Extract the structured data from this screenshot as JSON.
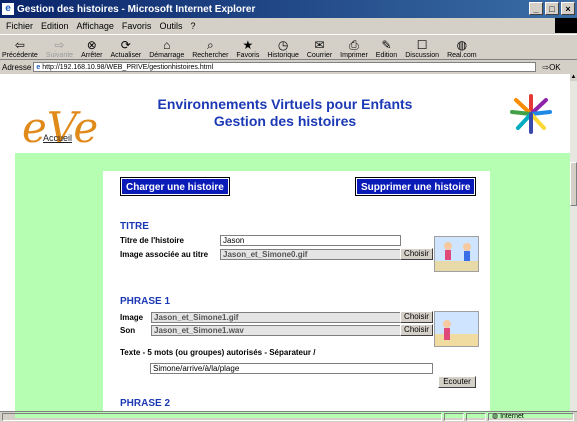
{
  "window": {
    "title": "Gestion des histoires - Microsoft Internet Explorer",
    "buttons": [
      "_",
      "□",
      "×"
    ]
  },
  "menu": {
    "items": [
      "Fichier",
      "Edition",
      "Affichage",
      "Favoris",
      "Outils",
      "?"
    ]
  },
  "toolbar": {
    "buttons": [
      {
        "label": "Précédente",
        "icon": "back-arrow",
        "glyph": "⇦"
      },
      {
        "label": "Suivante",
        "icon": "forward-arrow",
        "glyph": "⇨"
      },
      {
        "label": "Arrêter",
        "icon": "stop",
        "glyph": "⊗"
      },
      {
        "label": "Actualiser",
        "icon": "refresh",
        "glyph": "⟳"
      },
      {
        "label": "Démarrage",
        "icon": "home",
        "glyph": "⌂"
      },
      {
        "label": "Rechercher",
        "icon": "search",
        "glyph": "⌕"
      },
      {
        "label": "Favoris",
        "icon": "favorites",
        "glyph": "★"
      },
      {
        "label": "Historique",
        "icon": "history",
        "glyph": "◷"
      },
      {
        "label": "Courrier",
        "icon": "mail",
        "glyph": "✉"
      },
      {
        "label": "Imprimer",
        "icon": "print",
        "glyph": "⎙"
      },
      {
        "label": "Edition",
        "icon": "edit",
        "glyph": "✎"
      },
      {
        "label": "Discussion",
        "icon": "discussion",
        "glyph": "☐"
      },
      {
        "label": "Real.com",
        "icon": "real",
        "glyph": "◍"
      }
    ]
  },
  "address": {
    "label": "Adresse",
    "url": "http://192.168.10.98/WEB_PRIVE/gestionhistoires.html",
    "go_label": "OK"
  },
  "page": {
    "logo_text": "eVe",
    "home_link": "Accueil",
    "title_line1": "Environnements Virtuels pour Enfants",
    "title_line2": "Gestion des histoires",
    "load_button": "Charger une histoire",
    "delete_button": "Supprimer une histoire",
    "titre": {
      "heading": "TITRE",
      "title_label": "Titre de l'histoire",
      "title_value": "Jason",
      "image_label": "Image associée au titre",
      "image_value": "Jason_et_Simone0.gif",
      "choose_label": "Choisir"
    },
    "phrase1": {
      "heading": "PHRASE 1",
      "image_label": "Image",
      "image_value": "Jason_et_Simone1.gif",
      "sound_label": "Son",
      "sound_value": "Jason_et_Simone1.wav",
      "choose_label": "Choisir",
      "text_label": "Texte - 5 mots (ou groupes) autorisés - Séparateur /",
      "text_value": "Simone/arrive/à/la/plage",
      "listen_label": "Ecouter"
    },
    "phrase2": {
      "heading": "PHRASE 2"
    }
  },
  "status": {
    "zone": "Internet"
  },
  "colors": {
    "title_blue": "#1c39b5",
    "button_blue": "#0a1bb8",
    "green_bg": "#b6ffb2",
    "logo_orange": "#e08a1a"
  }
}
